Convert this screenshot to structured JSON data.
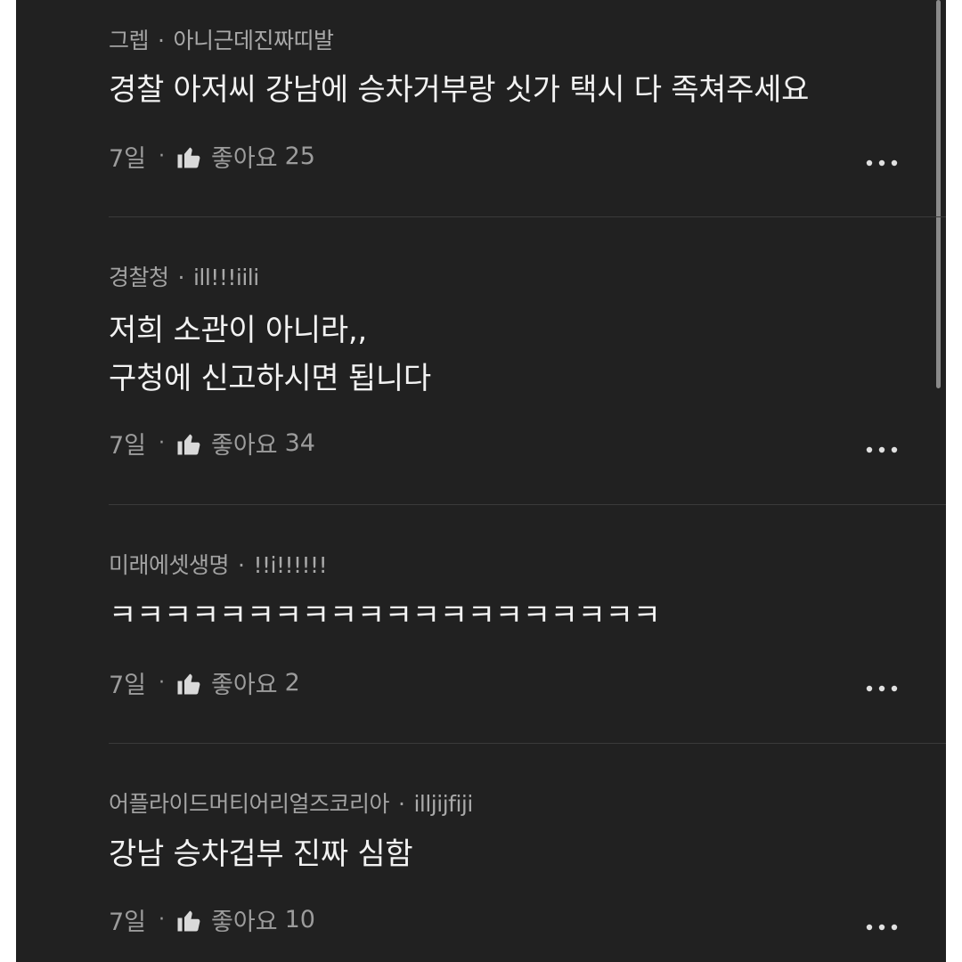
{
  "comments": [
    {
      "author": "그렙",
      "handle": "아니근데진짜띠발",
      "lines": [
        "경찰 아저씨 강남에 승차거부랑 싯가 택시 다 족쳐주세요"
      ],
      "age": "7일",
      "likes_label": "좋아요",
      "likes_count": "25"
    },
    {
      "author": "경찰청",
      "handle": "ill!!!iili",
      "lines": [
        "저희 소관이 아니라,,",
        "구청에 신고하시면 됩니다"
      ],
      "age": "7일",
      "likes_label": "좋아요",
      "likes_count": "34"
    },
    {
      "author": "미래에셋생명",
      "handle": "!!i!!!!!!",
      "lines": [
        "ㅋㅋㅋㅋㅋㅋㅋㅋㅋㅋㅋㅋㅋㅋㅋㅋㅋㅋㅋㅋ"
      ],
      "age": "7일",
      "likes_label": "좋아요",
      "likes_count": "2"
    },
    {
      "author": "어플라이드머티어리얼즈코리아",
      "handle": "illjijfiji",
      "lines": [
        "강남 승차겁부 진짜 심함"
      ],
      "age": "7일",
      "likes_label": "좋아요",
      "likes_count": "10"
    }
  ],
  "separator": "·",
  "icons": {
    "like": "thumbs-up-icon",
    "more": "more-options-icon"
  },
  "colors": {
    "background": "#212121",
    "text": "#f2f2f2",
    "meta": "#a3a3a3"
  }
}
